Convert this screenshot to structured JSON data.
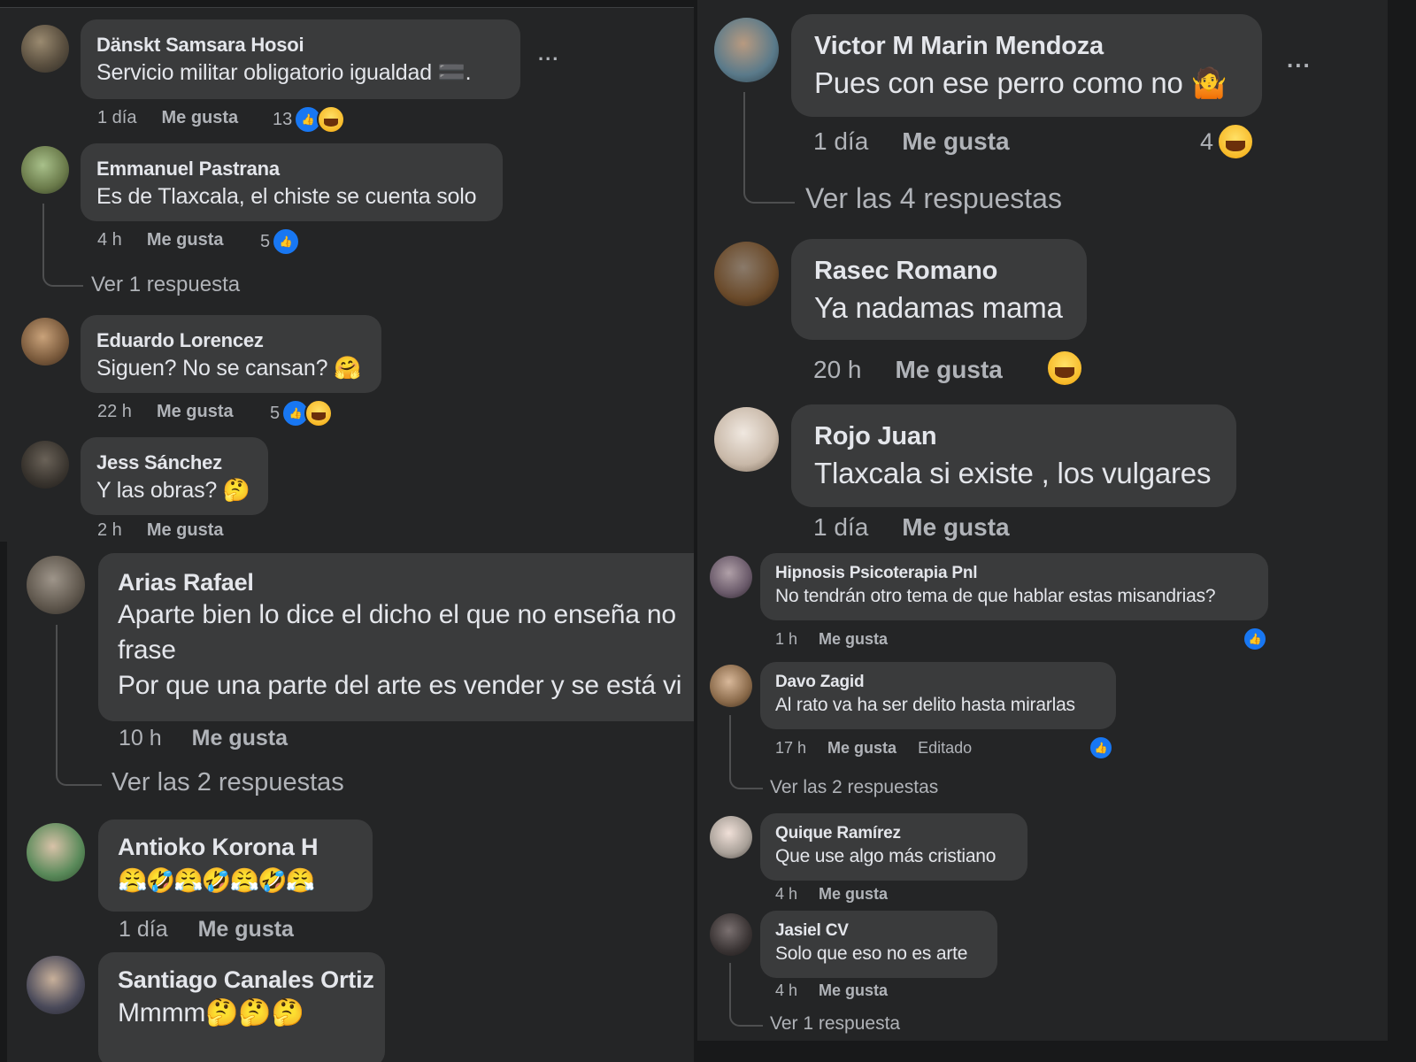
{
  "panel_left_top": {
    "comments": [
      {
        "name": "Dänskt Samsara Hosoi",
        "text": "Servicio militar obligatorio igualdad 🟰.",
        "time": "1 día",
        "like": "Me gusta",
        "count": "13"
      },
      {
        "name": "Emmanuel Pastrana",
        "text": "Es de Tlaxcala, el chiste se cuenta solo",
        "time": "4 h",
        "like": "Me gusta",
        "count": "5",
        "replies": "Ver 1 respuesta"
      },
      {
        "name": "Eduardo Lorencez",
        "text": "Siguen? No se cansan? 🤗",
        "time": "22 h",
        "like": "Me gusta",
        "count": "5"
      },
      {
        "name": "Jess Sánchez",
        "text": "Y las obras? 🤔",
        "time": "2 h",
        "like": "Me gusta"
      }
    ],
    "more": "..."
  },
  "panel_left_bottom": {
    "comments": [
      {
        "name": "Arias Rafael",
        "line1": "Aparte bien lo dice el dicho el que no enseña no",
        "line2": "frase",
        "line3": "Por que una parte del arte es vender y se está vi",
        "time": "10 h",
        "like": "Me gusta",
        "replies": "Ver las 2 respuestas"
      },
      {
        "name": "Antioko Korona H",
        "text": "😤🤣😤🤣😤🤣😤",
        "time": "1 día",
        "like": "Me gusta"
      },
      {
        "name": "Santiago Canales Ortiz",
        "text": "Mmmm🤔🤔🤔"
      }
    ]
  },
  "panel_right_top": {
    "comments": [
      {
        "name": "Victor M Marin Mendoza",
        "text": "Pues con ese perro como no 🤷",
        "time": "1 día",
        "like": "Me gusta",
        "count": "4",
        "replies": "Ver las 4 respuestas"
      },
      {
        "name": "Rasec Romano",
        "text": "Ya nadamas mama",
        "time": "20 h",
        "like": "Me gusta"
      },
      {
        "name": "Rojo Juan",
        "text": "Tlaxcala si existe , los vulgares",
        "time": "1 día",
        "like": "Me gusta"
      }
    ],
    "more": "..."
  },
  "panel_right_bottom": {
    "comments": [
      {
        "name": "Hipnosis Psicoterapia Pnl",
        "text": "No tendrán otro tema de que hablar estas misandrias?",
        "time": "1 h",
        "like": "Me gusta"
      },
      {
        "name": "Davo Zagid",
        "text": "Al rato va ha ser delito hasta mirarlas",
        "time": "17 h",
        "like": "Me gusta",
        "edited": "Editado",
        "replies": "Ver las 2 respuestas"
      },
      {
        "name": "Quique Ramírez",
        "text": "Que use algo más cristiano",
        "time": "4 h",
        "like": "Me gusta"
      },
      {
        "name": "Jasiel CV",
        "text": "Solo que eso no es arte",
        "time": "4 h",
        "like": "Me gusta",
        "replies": "Ver 1 respuesta"
      }
    ]
  },
  "icons": {
    "like": "thumbs-up-icon",
    "haha": "laughing-face-icon",
    "more": "more-options-icon"
  },
  "colors": {
    "background": "#18191a",
    "panel": "#242526",
    "bubble": "#3a3b3c",
    "like_blue": "#1877f2",
    "meta_gray": "#b0b3b8"
  }
}
